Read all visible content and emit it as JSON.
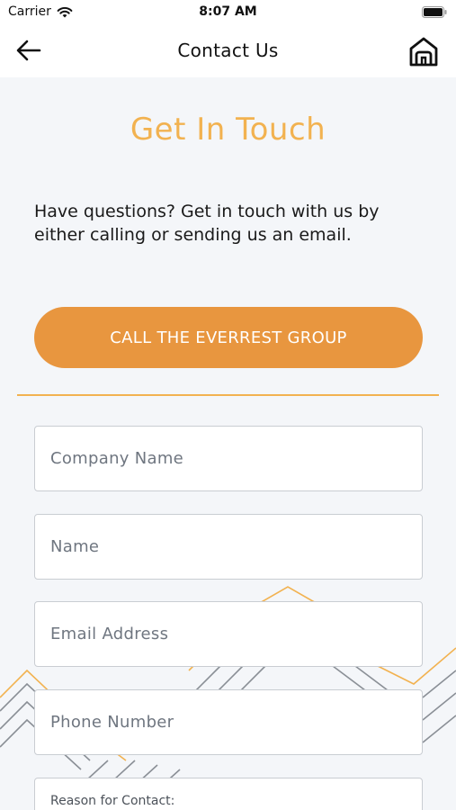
{
  "status_bar": {
    "carrier": "Carrier",
    "time": "8:07 AM"
  },
  "nav": {
    "title": "Contact Us",
    "back_icon": "arrow-left-icon",
    "home_icon": "home-icon"
  },
  "main": {
    "heading": "Get In Touch",
    "intro": "Have questions? Get in touch with us by either calling or sending us an email.",
    "call_button": "CALL THE EVERREST GROUP"
  },
  "form": {
    "company_placeholder": "Company Name",
    "name_placeholder": "Name",
    "email_placeholder": "Email Address",
    "phone_placeholder": "Phone Number",
    "reason_label": "Reason for Contact:"
  },
  "colors": {
    "accent": "#f2b250",
    "button": "#e8963f",
    "background": "#f4f6f9"
  }
}
